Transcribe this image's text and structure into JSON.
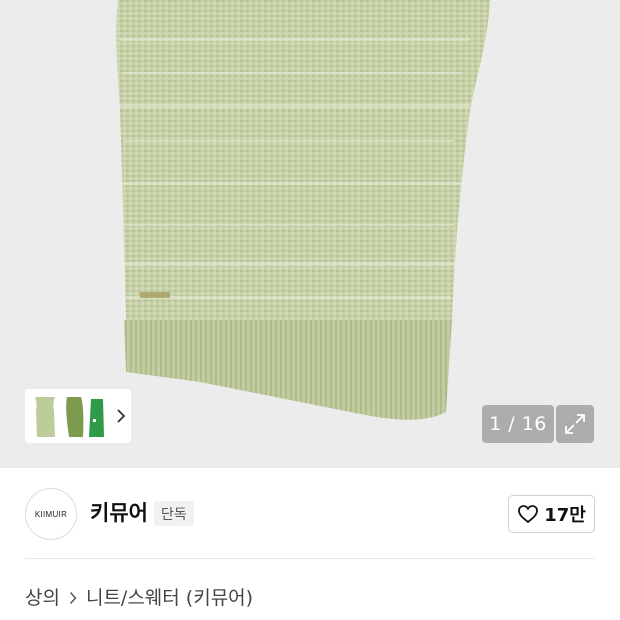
{
  "gallery": {
    "counter": "1 / 16",
    "expand_icon": "expand-arrows-icon",
    "thumbnail_more_icon": "chevron-right-icon",
    "colors": {
      "background": "#ececec",
      "knit": "#c4cfa6"
    }
  },
  "brand": {
    "logo_text": "KIIMUIR",
    "name": "키뮤어",
    "badge": "단독",
    "like_icon": "heart-outline-icon",
    "like_count": "17만"
  },
  "breadcrumb": {
    "items": [
      "상의",
      "니트/스웨터 (키뮤어)"
    ],
    "separator_icon": "chevron-right-icon"
  }
}
